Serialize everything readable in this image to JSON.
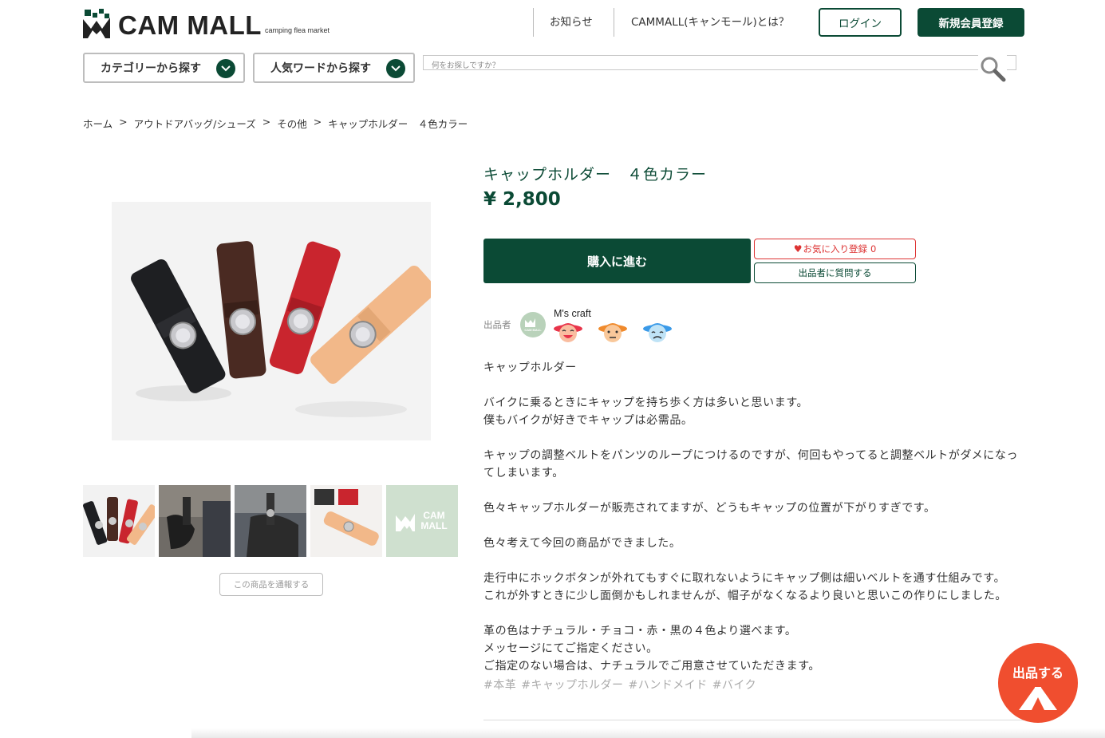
{
  "header": {
    "logo_text": "CAM MALL",
    "logo_sub": "camping flea market",
    "news_link": "お知らせ",
    "about_link": "CAMMALL(キャンモール)とは？",
    "login_label": "ログイン",
    "register_label": "新規会員登録"
  },
  "filters": {
    "category_label": "カテゴリーから探す",
    "popular_label": "人気ワードから探す"
  },
  "search": {
    "placeholder": "何をお探しですか？"
  },
  "breadcrumb": {
    "items": [
      "ホーム",
      "アウトドアバッグ/シューズ",
      "その他",
      "キャップホルダー　４色カラー"
    ],
    "separator": ">"
  },
  "product": {
    "title": "キャップホルダー　４色カラー",
    "price": "¥ 2,800",
    "buy_label": "購入に進む",
    "favorite_label": "お気に入り登録",
    "favorite_count": "0",
    "ask_label": "出品者に質問する",
    "report_label": "この商品を通報する",
    "thumbnail_logo": "CAM MALL"
  },
  "seller": {
    "label": "出品者",
    "name": "M's craft",
    "avatar_text": "CAM MALL",
    "ratings": [
      "good-face-icon",
      "normal-face-icon",
      "bad-face-icon"
    ]
  },
  "description": {
    "paragraphs": [
      "キャップホルダー",
      "バイクに乗るときにキャップを持ち歩く方は多いと思います。\n僕もバイクが好きでキャップは必需品。",
      "キャップの調整ベルトをパンツのループにつけるのですが、何回もやってると調整ベルトがダメになってしまいます。",
      "色々キャップホルダーが販売されてますが、どうもキャップの位置が下がりすぎです。",
      "色々考えて今回の商品ができました。",
      "走行中にホックボタンが外れてもすぐに取れないようにキャップ側は細いベルトを通す仕組みです。\nこれが外すときに少し面倒かもしれませんが、帽子がなくなるより良いと思いこの作りにしました。",
      "革の色はナチュラル・チョコ・赤・黒の４色より選べます。\nメッセージにてご指定ください。\nご指定のない場合は、ナチュラルでご用意させていただきます。"
    ],
    "tags": [
      "#本革",
      "#キャップホルダー",
      "#ハンドメイド",
      "#バイク"
    ]
  },
  "fab": {
    "label": "出品する"
  },
  "colors": {
    "brand_green": "#0b4a35",
    "favorite_red": "#dd3333",
    "fab_orange": "#f04e2f",
    "leather_black": "#1e1f22",
    "leather_chocolate": "#4a2a22",
    "leather_red": "#c9252e",
    "leather_natural": "#f2b889"
  }
}
